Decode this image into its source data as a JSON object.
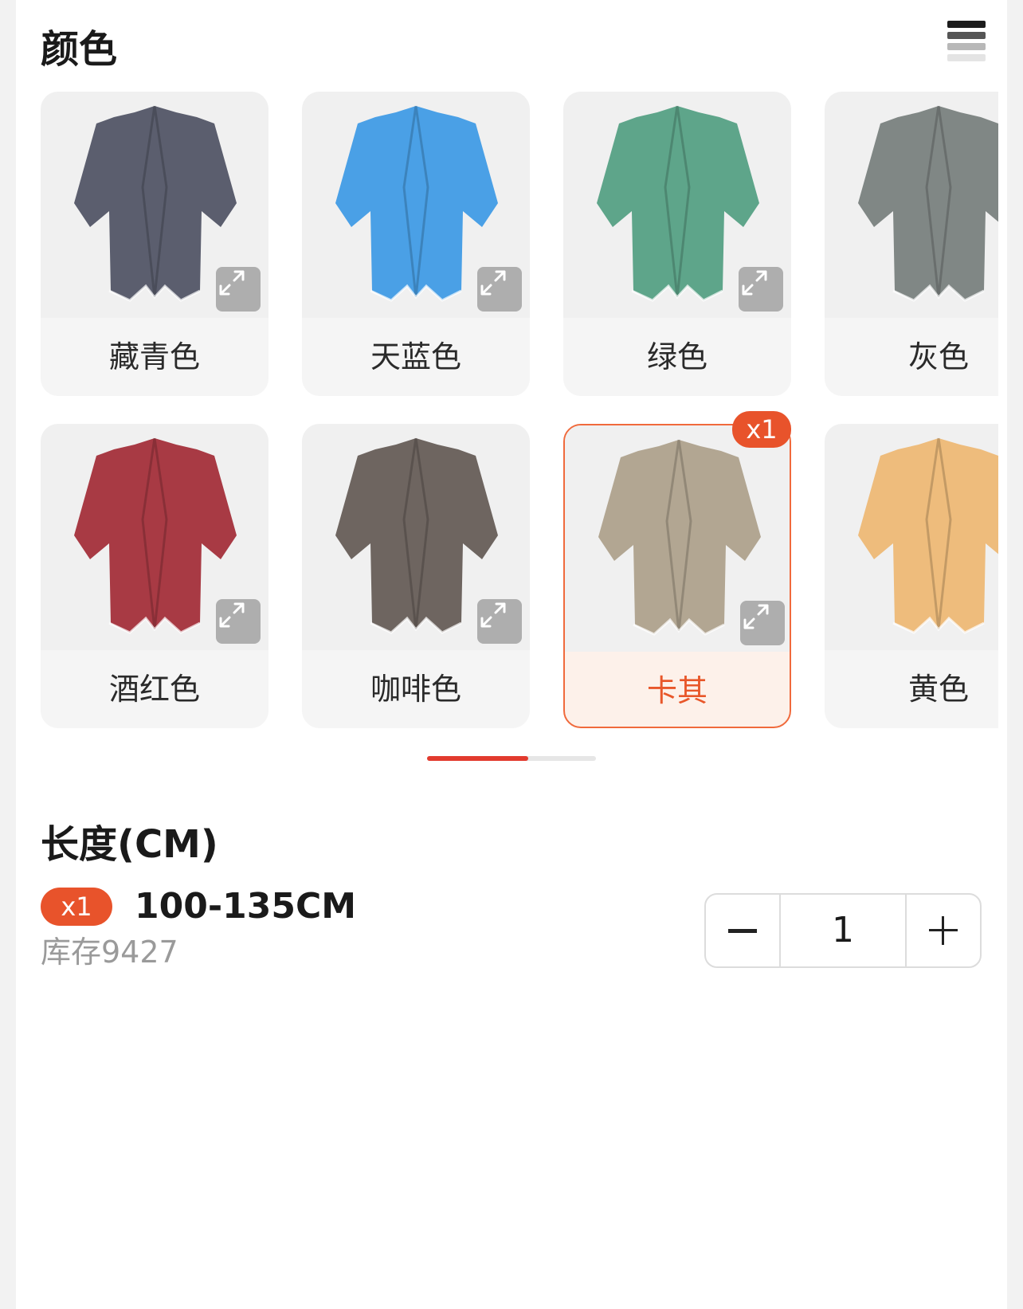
{
  "sections": {
    "color_title": "颜色",
    "length_title": "长度(CM)"
  },
  "colors": [
    {
      "label": "藏青色",
      "swatch": "#5b5e6e",
      "selected": false
    },
    {
      "label": "天蓝色",
      "swatch": "#4aa0e6",
      "selected": false
    },
    {
      "label": "绿色",
      "swatch": "#5ea58a",
      "selected": false
    },
    {
      "label": "灰色",
      "swatch": "#808785",
      "selected": false
    },
    {
      "label": "酒红色",
      "swatch": "#a83a44",
      "selected": false
    },
    {
      "label": "咖啡色",
      "swatch": "#6e6560",
      "selected": false
    },
    {
      "label": "卡其",
      "swatch": "#b2a692",
      "selected": true,
      "badge": "x1"
    },
    {
      "label": "黄色",
      "swatch": "#eebc7c",
      "selected": false
    }
  ],
  "length_option": {
    "badge": "x1",
    "name": "100-135CM",
    "stock": "库存9427"
  },
  "stepper": {
    "value": "1"
  },
  "scroll_indicator": {
    "progress": 0.6
  },
  "theme": {
    "accent": "#e8532b",
    "scroll_thumb": "#e23a2e"
  },
  "icons": {
    "menu": "stacked-bars-icon",
    "expand": "expand-arrows-icon",
    "minus": "minus-icon",
    "plus": "plus-icon"
  }
}
